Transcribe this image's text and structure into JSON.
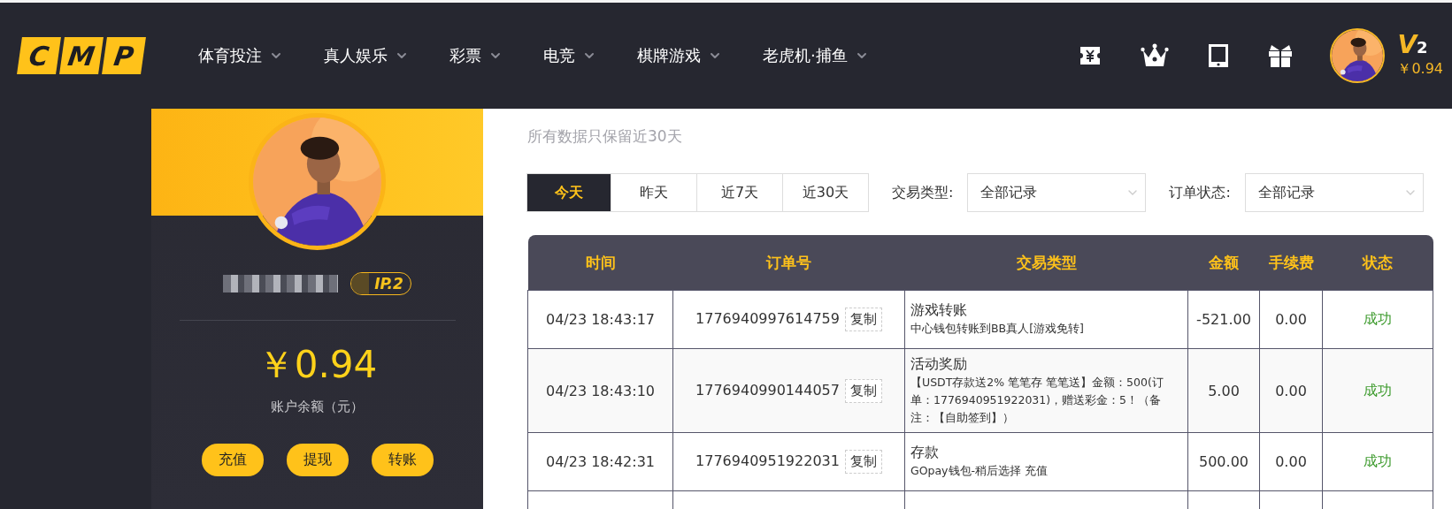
{
  "header": {
    "logo": [
      "C",
      "M",
      "P"
    ],
    "nav": [
      {
        "label": "体育投注"
      },
      {
        "label": "真人娱乐"
      },
      {
        "label": "彩票"
      },
      {
        "label": "电竞"
      },
      {
        "label": "棋牌游戏"
      },
      {
        "label": "老虎机·捕鱼"
      }
    ],
    "user": {
      "vip_letter": "V",
      "vip_level": "2",
      "balance": "￥0.94"
    }
  },
  "profile": {
    "vip_badge": "IP.2",
    "balance": "￥0.94",
    "balance_label": "账户余额（元）",
    "actions": [
      "充值",
      "提现",
      "转账"
    ]
  },
  "records": {
    "note": "所有数据只保留近30天",
    "ranges": [
      {
        "label": "今天",
        "selected": true
      },
      {
        "label": "昨天",
        "selected": false
      },
      {
        "label": "近7天",
        "selected": false
      },
      {
        "label": "近30天",
        "selected": false
      }
    ],
    "filters": [
      {
        "label": "交易类型:",
        "value": "全部记录"
      },
      {
        "label": "订单状态:",
        "value": "全部记录"
      }
    ],
    "table": {
      "columns": [
        "时间",
        "订单号",
        "交易类型",
        "金额",
        "手续费",
        "状态"
      ],
      "rows": [
        {
          "time": "04/23 18:43:17",
          "order": "1776940997614759",
          "copy": "复制",
          "type": "游戏转账",
          "detail": "中心钱包转账到BB真人[游戏免转]",
          "amount": "-521.00",
          "fee": "0.00",
          "status": "成功"
        },
        {
          "time": "04/23 18:43:10",
          "order": "1776940990144057",
          "copy": "复制",
          "type": "活动奖励",
          "detail": "【USDT存款送2% 笔笔存 笔笔送】金额：500(订单：1776940951922031)，赠送彩金：5！（备注：【自助签到】）",
          "amount": "5.00",
          "fee": "0.00",
          "status": "成功"
        },
        {
          "time": "04/23 18:42:31",
          "order": "1776940951922031",
          "copy": "复制",
          "type": "存款",
          "detail": "GOpay钱包-稍后选择 充值",
          "amount": "500.00",
          "fee": "0.00",
          "status": "成功"
        }
      ]
    }
  }
}
